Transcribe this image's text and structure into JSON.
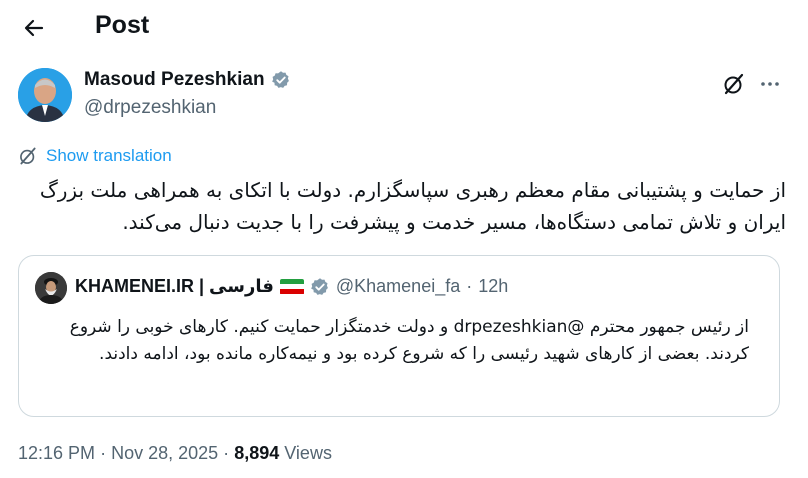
{
  "header": {
    "title": "Post",
    "back_icon": "arrow-left-icon"
  },
  "author": {
    "name": "Masoud Pezeshkian",
    "handle": "@drpezeshkian",
    "verified": true,
    "verified_color": "#829aab"
  },
  "actions": {
    "grok_icon": "grok-icon",
    "more_icon": "more-icon"
  },
  "translation": {
    "label": "Show translation",
    "color": "#1d9bf0"
  },
  "tweet": {
    "text": "از حمایت و پشتیبانی مقام معظم رهبری سپاسگزارم. دولت با اتکای به همراهی ملت بزرگ ایران و تلاش تمامی دستگاه‌ها، مسیر خدمت و پیشرفت را با جدیت دنبال می‌کند."
  },
  "quote": {
    "name": "KHAMENEI.IR | فارسی",
    "handle": "@Khamenei_fa",
    "separator": "·",
    "time": "12h",
    "text": "از رئیس جمهور محترم @drpezeshkian و دولت خدمتگزار حمایت کنیم. کارهای خوبی را شروع کردند. بعضی از کارهای شهید رئیسی را که شروع کرده بود و نیمه‌کاره مانده بود، ادامه دادند."
  },
  "meta": {
    "time": "12:16 PM",
    "sep1": "·",
    "date": "Nov 28, 2025",
    "sep2": "·",
    "views_count": "8,894",
    "views_label": "Views"
  }
}
